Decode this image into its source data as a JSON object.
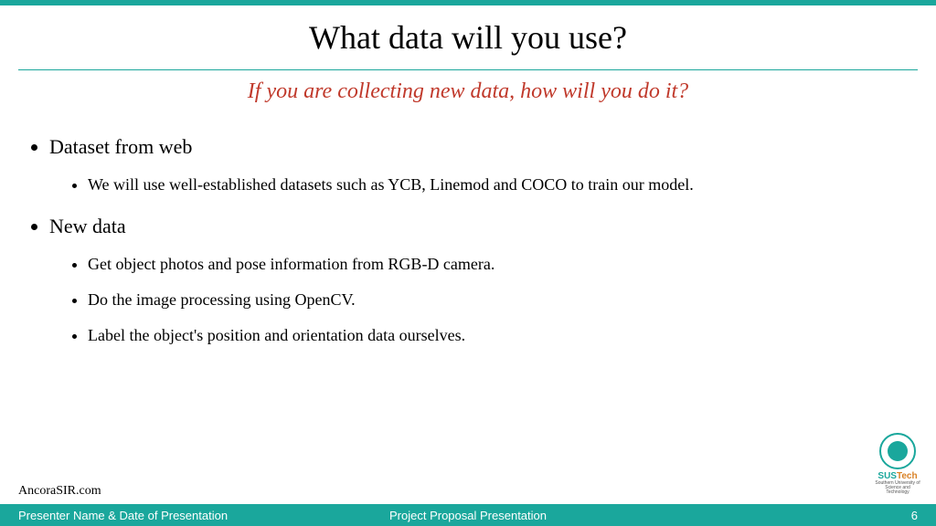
{
  "title": "What data will you use?",
  "subtitle": "If you are collecting new data, how will you do it?",
  "bullets": {
    "b1": "Dataset from web",
    "b1_1": "We will use well-established datasets such as YCB, Linemod and COCO to train our model.",
    "b2": "New data",
    "b2_1": "Get object photos and pose information from RGB-D camera.",
    "b2_2": "Do the image processing using OpenCV.",
    "b2_3": "Label the object's position and orientation data ourselves."
  },
  "site": "AncoraSIR.com",
  "footer": {
    "left": "Presenter Name & Date of Presentation",
    "center": "Project Proposal Presentation",
    "page": "6"
  },
  "logo": {
    "brand_a": "SUS",
    "brand_b": "Tech",
    "sub": "Southern University of Science and Technology"
  }
}
